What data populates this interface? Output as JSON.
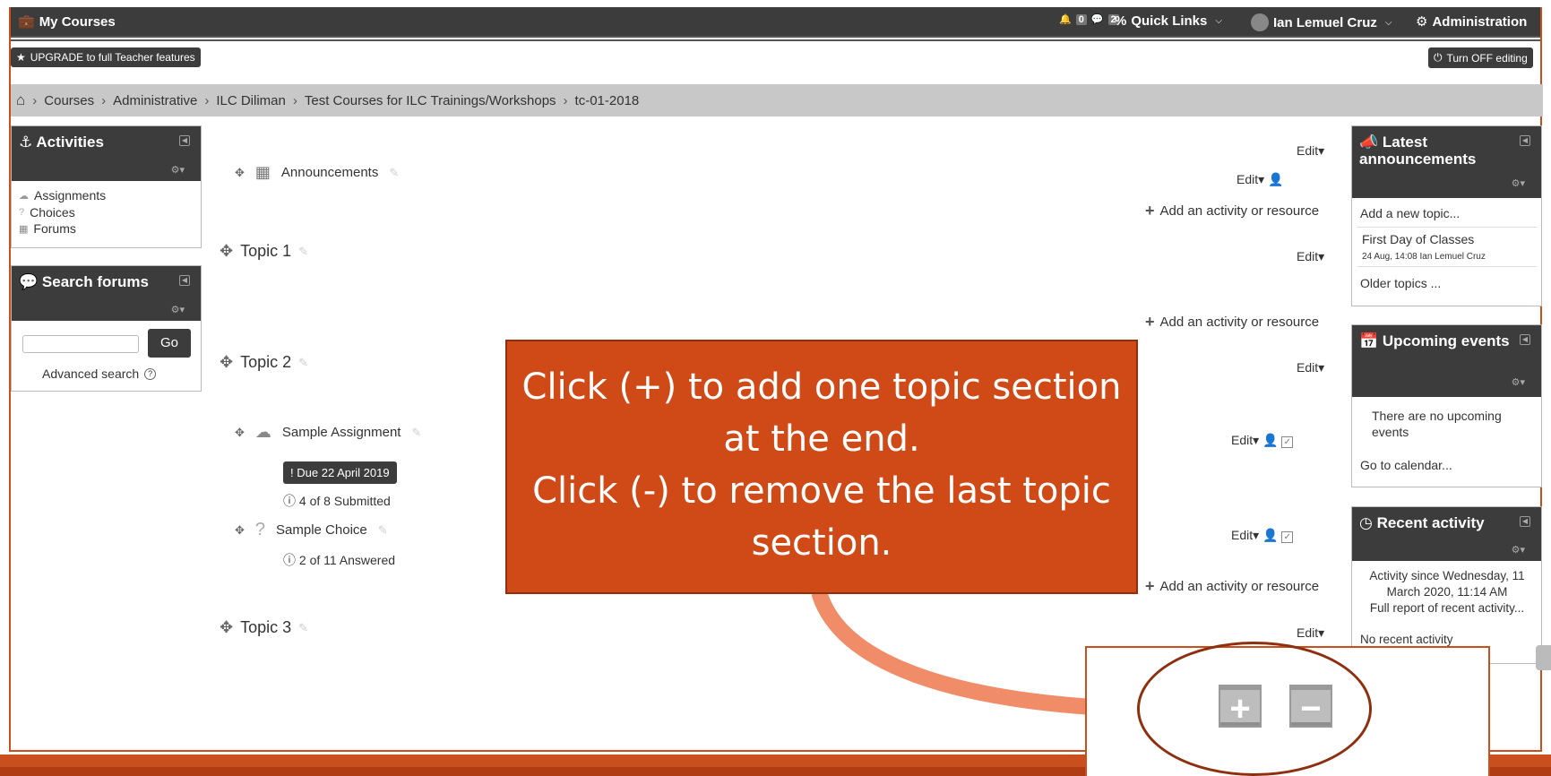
{
  "navbar": {
    "my_courses": "My Courses",
    "msg_count": "0",
    "notif_count": "2",
    "quick_links": "Quick Links",
    "user_name": "Ian Lemuel Cruz",
    "administration": "Administration"
  },
  "toolbar": {
    "upgrade": "UPGRADE to full Teacher features",
    "turn_off_editing": "Turn OFF editing"
  },
  "breadcrumb": [
    "Courses",
    "Administrative",
    "ILC Diliman",
    "Test Courses for ILC Trainings/Workshops",
    "tc-01-2018"
  ],
  "activities_block": {
    "title": "Activities",
    "items": [
      "Assignments",
      "Choices",
      "Forums"
    ]
  },
  "search_block": {
    "title": "Search forums",
    "go": "Go",
    "advanced": "Advanced search"
  },
  "main": {
    "edit": "Edit",
    "add_activity": "Add an activity or resource",
    "announcements": "Announcements",
    "topic1": "Topic 1",
    "topic2": "Topic 2",
    "topic3": "Topic 3",
    "assignment": "Sample Assignment",
    "due": "Due 22 April 2019",
    "submitted": "4 of 8 Submitted",
    "choice": "Sample Choice",
    "answered": "2 of 11 Answered"
  },
  "announcements_block": {
    "title": "Latest announcements",
    "add_topic": "Add a new topic...",
    "post_title": "First Day of Classes",
    "post_meta": "24 Aug, 14:08  Ian Lemuel Cruz",
    "older": "Older topics ..."
  },
  "events_block": {
    "title": "Upcoming events",
    "empty": "There are no upcoming events",
    "calendar": "Go to calendar..."
  },
  "recent_block": {
    "title": "Recent activity",
    "since": "Activity since Wednesday, 11 March 2020, 11:14 AM",
    "full_report": "Full report of recent activity...",
    "none": "No recent activity"
  },
  "callout": {
    "line1": "Click (+) to add one topic section",
    "line2": "at the end.",
    "line3": "Click (-) to remove the last topic",
    "line4": "section."
  },
  "colors": {
    "accent": "#d04a18",
    "dark": "#3c3c3c",
    "breadcrumb_bg": "#c8c8c8"
  }
}
